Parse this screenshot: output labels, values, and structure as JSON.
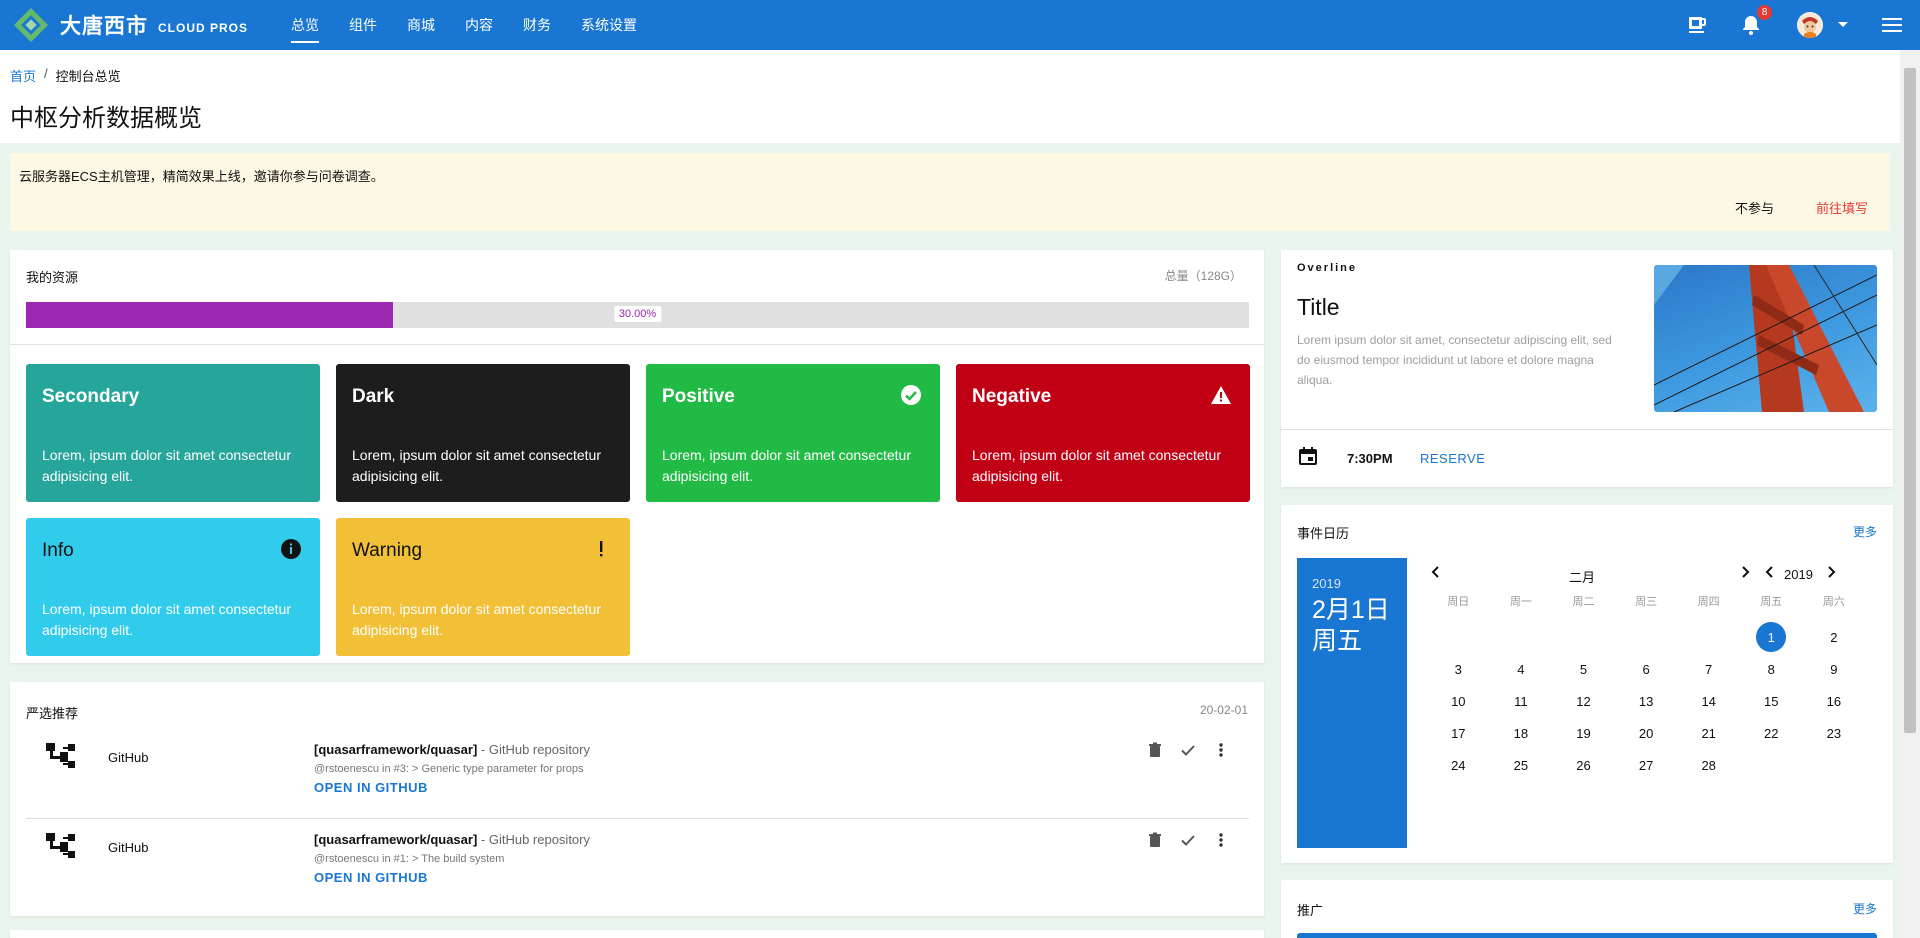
{
  "brand": {
    "title": "大唐西市",
    "subtitle": "CLOUD PROS",
    "color": "#1976d2"
  },
  "nav": [
    {
      "label": "总览",
      "active": true
    },
    {
      "label": "组件",
      "active": false
    },
    {
      "label": "商城",
      "active": false
    },
    {
      "label": "内容",
      "active": false
    },
    {
      "label": "财务",
      "active": false
    },
    {
      "label": "系统设置",
      "active": false
    }
  ],
  "topbar": {
    "notification_count": "8",
    "icons": [
      "coffee-icon",
      "bell-icon",
      "avatar",
      "chevron-down-icon",
      "menu-icon"
    ]
  },
  "breadcrumb": {
    "home": "首页",
    "separator": "/",
    "current": "控制台总览"
  },
  "page_title": "中枢分析数据概览",
  "alert": {
    "text": "云服务器ECS主机管理，精简效果上线，邀请你参与问卷调查。",
    "decline": "不参与",
    "go": "前往填写"
  },
  "resources": {
    "title": "我的资源",
    "total": "总量（128G）",
    "progress": 0.3,
    "progress_label": "30.00%",
    "progress_color": "#9c27b0",
    "tiles": [
      {
        "title": "Secondary",
        "body": "Lorem, ipsum dolor sit amet consectetur adipisicing elit.",
        "color": "#26a69a",
        "icon": ""
      },
      {
        "title": "Dark",
        "body": "Lorem, ipsum dolor sit amet consectetur adipisicing elit.",
        "color": "#1d1d1d",
        "icon": ""
      },
      {
        "title": "Positive",
        "body": "Lorem, ipsum dolor sit amet consectetur adipisicing elit.",
        "color": "#21ba45",
        "icon": "check-circle-icon"
      },
      {
        "title": "Negative",
        "body": "Lorem, ipsum dolor sit amet consectetur adipisicing elit.",
        "color": "#c10015",
        "icon": "warning-icon"
      },
      {
        "title": "Info",
        "body": "Lorem, ipsum dolor sit amet consectetur adipisicing elit.",
        "color": "#31ccec",
        "icon": "info-icon"
      },
      {
        "title": "Warning",
        "body": "Lorem, ipsum dolor sit amet consectetur adipisicing elit.",
        "color": "#f2c037",
        "icon": "exclamation-icon"
      }
    ]
  },
  "recommend": {
    "title": "严选推荐",
    "date": "20-02-01",
    "items": [
      {
        "name": "GitHub",
        "repo": "[quasarframework/quasar]",
        "repo_suffix": " - GitHub repository",
        "caption": "@rstoenescu in #3: > Generic type parameter for props",
        "action": "OPEN IN GITHUB"
      },
      {
        "name": "GitHub",
        "repo": "[quasarframework/quasar]",
        "repo_suffix": " - GitHub repository",
        "caption": "@rstoenescu in #1: > The build system",
        "action": "OPEN IN GITHUB"
      }
    ]
  },
  "media": {
    "overline": "Overline",
    "title": "Title",
    "text": "Lorem ipsum dolor sit amet, consectetur adipiscing elit, sed do eiusmod tempor incididunt ut labore et dolore magna aliqua.",
    "time": "7:30PM",
    "action": "RESERVE"
  },
  "calendar": {
    "title": "事件日历",
    "more": "更多",
    "year": "2019",
    "selected_label": "2月1日",
    "selected_weekday": "周五",
    "month": "二月",
    "weekdays": [
      "周日",
      "周一",
      "周二",
      "周三",
      "周四",
      "周五",
      "周六"
    ],
    "leading_blanks": 5,
    "days": 28,
    "selected_day": 1
  },
  "promo": {
    "title": "推广",
    "more": "更多"
  }
}
